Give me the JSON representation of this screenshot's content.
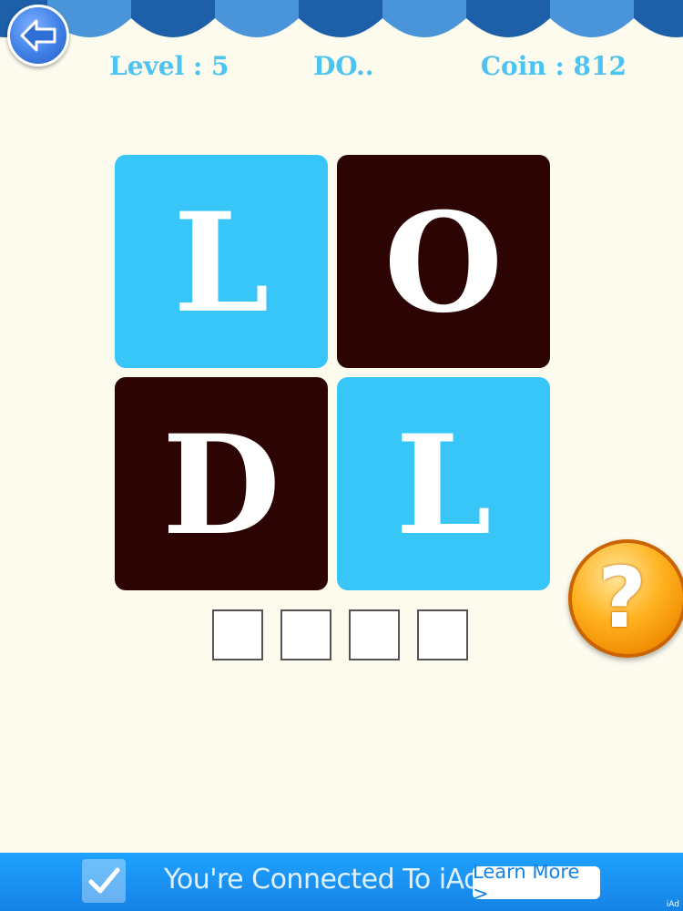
{
  "colors": {
    "background": "#fcfbee",
    "awning_dark": "#1d5fa8",
    "awning_light": "#4a95d9",
    "header_text": "#4cc3f1",
    "tile_light": "#38c5f7",
    "tile_dark": "#2d0404",
    "ad_blue": "#1583e6"
  },
  "header": {
    "back_icon": "back-arrow-icon",
    "level": "Level : 5",
    "word_hint": "DO..",
    "coin": "Coin : 812"
  },
  "tiles": [
    {
      "letter": "L",
      "color": "#38c5f7"
    },
    {
      "letter": "O",
      "color": "#2d0404"
    },
    {
      "letter": "D",
      "color": "#2d0404"
    },
    {
      "letter": "L",
      "color": "#38c5f7"
    }
  ],
  "answer_slots": [
    "",
    "",
    "",
    ""
  ],
  "hint": {
    "label": "?",
    "icon": "question-mark-icon"
  },
  "ad": {
    "check_icon": "checkmark-icon",
    "message": "You're Connected To iAd",
    "button": "Learn More >",
    "corner": "iAd"
  }
}
